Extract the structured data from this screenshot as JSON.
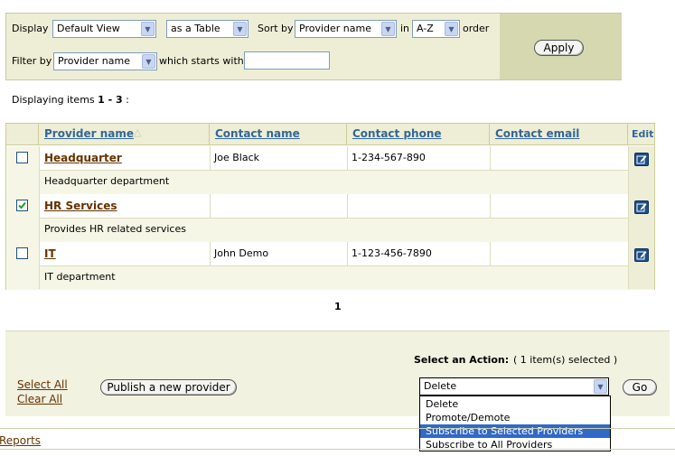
{
  "filter": {
    "display_label": "Display",
    "view_value": "Default View",
    "as_value": "as a Table",
    "sort_label": "Sort by",
    "sort_value": "Provider name",
    "in_label": "in",
    "order_value": "A-Z",
    "order_label": "order",
    "filter_label": "Filter by",
    "filter_value": "Provider name",
    "starts_label": "which starts with",
    "starts_input": "",
    "apply_label": "Apply"
  },
  "status": {
    "prefix": "Displaying items ",
    "range": "1 - 3",
    "suffix": " :"
  },
  "table": {
    "columns": [
      "Provider name",
      "Contact name",
      "Contact phone",
      "Contact email",
      "Edit"
    ],
    "sort_indicator": "△",
    "rows": [
      {
        "name": "Headquarter",
        "contact": "Joe Black",
        "phone": "1-234-567-890",
        "email": "",
        "description": "Headquarter department",
        "checked": false
      },
      {
        "name": "HR Services",
        "contact": "",
        "phone": "",
        "email": "",
        "description": "Provides HR related services",
        "checked": true
      },
      {
        "name": "IT",
        "contact": "John Demo",
        "phone": "1-123-456-7890",
        "email": "",
        "description": "IT department",
        "checked": false
      }
    ]
  },
  "pager": {
    "current": "1"
  },
  "actions": {
    "select_all": "Select All",
    "clear_all": "Clear All",
    "publish_label": "Publish a new provider",
    "select_action_label": "Select an Action:",
    "selected_count": "( 1 item(s) selected )",
    "action_value": "Delete",
    "go_label": "Go",
    "options": [
      "Delete",
      "Promote/Demote",
      "Subscribe to Selected Providers",
      "Subscribe to All Providers"
    ],
    "highlighted_option": "Subscribe to Selected Providers"
  },
  "footer": {
    "reports_link": "Reports"
  },
  "colors": {
    "panel": "#eeeed6",
    "apply_cell": "#d6d8b0",
    "header_link": "#336699",
    "provider_link": "#663300",
    "highlight": "#3169c6"
  },
  "icons": {
    "dropdown": "chevron-down-icon",
    "edit": "edit-pencil-icon",
    "check": "checkmark-icon"
  }
}
